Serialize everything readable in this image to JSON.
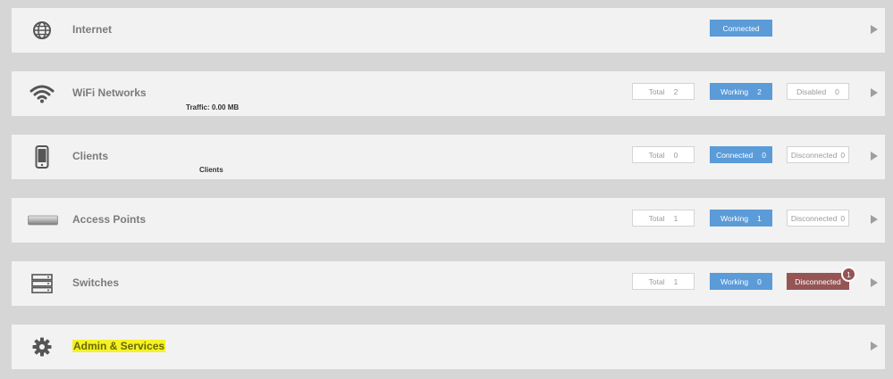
{
  "rows": [
    {
      "title": "Internet",
      "status": "Connected"
    },
    {
      "title": "WiFi Networks",
      "subtitle": "Traffic: 0.00 MB",
      "total_label": "Total",
      "total_value": "2",
      "working_label": "Working",
      "working_value": "2",
      "disabled_label": "Disabled",
      "disabled_value": "0"
    },
    {
      "title": "Clients",
      "subtitle": "Clients",
      "total_label": "Total",
      "total_value": "0",
      "connected_label": "Connected",
      "connected_value": "0",
      "disconnected_label": "Disconnected",
      "disconnected_value": "0"
    },
    {
      "title": "Access Points",
      "total_label": "Total",
      "total_value": "1",
      "working_label": "Working",
      "working_value": "1",
      "disconnected_label": "Disconnected",
      "disconnected_value": "0"
    },
    {
      "title": "Switches",
      "total_label": "Total",
      "total_value": "1",
      "working_label": "Working",
      "working_value": "0",
      "disconnected_label": "Disconnected",
      "badge_count": "1"
    },
    {
      "title": "Admin & Services"
    }
  ],
  "colors": {
    "blue": "#5b9bd8",
    "red": "#965555",
    "highlight": "#f4f224"
  },
  "icons": [
    "globe-icon",
    "wifi-icon",
    "phone-icon",
    "access-point-icon",
    "switch-icon",
    "gear-icon"
  ]
}
